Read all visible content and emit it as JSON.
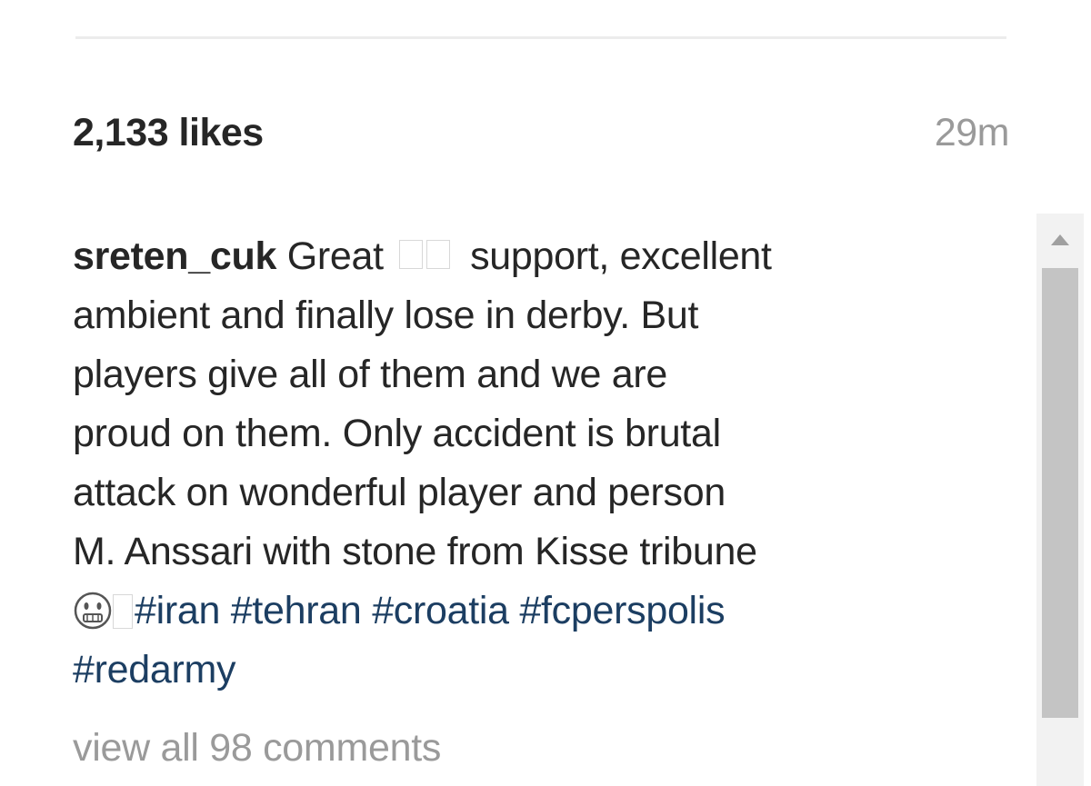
{
  "post": {
    "likes": "2,133 likes",
    "time": "29m"
  },
  "caption": {
    "username": "sreten_cuk",
    "lines": {
      "l1_pre": " Great ",
      "l1_post": " support, excellent",
      "l2": "ambient and finally lose in derby. But",
      "l3": "players give all of them and we are",
      "l4": "proud on them. Only accident is brutal",
      "l5": "attack on wonderful player and person",
      "l6": "M. Anssari with stone from Kisse tribune"
    },
    "hashtags": [
      "#iran",
      "#tehran",
      "#croatia",
      "#fcperspolis",
      "#redarmy"
    ]
  },
  "comments": {
    "view_all": "view all 98 comments"
  },
  "icons": {
    "flag": "flag-icon-placeholder",
    "emoji": "worried-face-icon",
    "scroll_up": "chevron-up-icon"
  },
  "colors": {
    "text": "#262626",
    "muted": "#9a9a9a",
    "hashtag": "#1c3e62"
  }
}
